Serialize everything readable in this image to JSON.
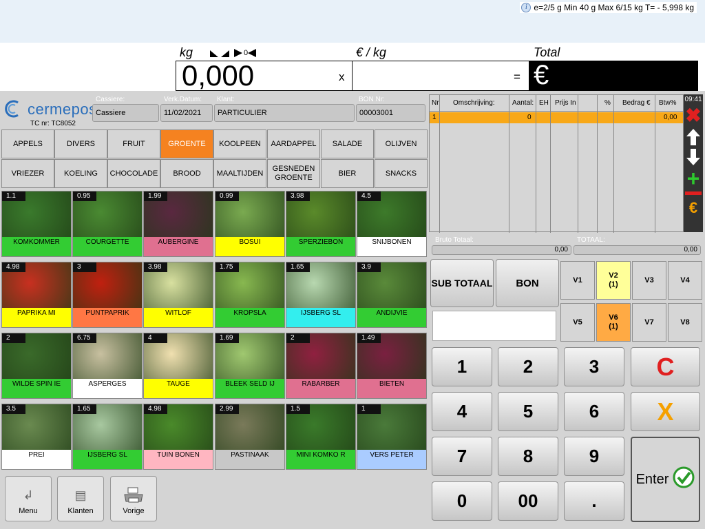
{
  "scale": {
    "info": "e=2/5 g   Min 40 g   Max 6/15 kg  T= - 5,998 kg"
  },
  "display": {
    "kg_label": "kg",
    "zero_indicator": "0",
    "eur_kg_label": "€ / kg",
    "total_label": "Total",
    "weight_value": "0,000",
    "multiply": "x",
    "equals": "=",
    "currency": "€"
  },
  "header": {
    "logo": "cermepos",
    "tc_nr": "TC nr: TC8052",
    "cashier_label": "Cassiere:",
    "cashier_value": "Cassiere",
    "date_label": "Verk.Datum:",
    "date_value": "11/02/2021",
    "client_label": "Klant:",
    "client_value": "PARTICULIER",
    "bon_label": "BON Nr:",
    "bon_value": "00003001"
  },
  "categories": [
    {
      "label": "APPELS"
    },
    {
      "label": "DIVERS"
    },
    {
      "label": "FRUIT"
    },
    {
      "label": "GROENTE",
      "active": true
    },
    {
      "label": "KOOLPEEN"
    },
    {
      "label": "AARDAPPEL"
    },
    {
      "label": "SALADE"
    },
    {
      "label": "OLIJVEN"
    },
    {
      "label": "VRIEZER"
    },
    {
      "label": "KOELING"
    },
    {
      "label": "CHOCOLADE"
    },
    {
      "label": "BROOD"
    },
    {
      "label": "MAALTIJDEN"
    },
    {
      "label": "GESNEDEN GROENTE"
    },
    {
      "label": "BIER"
    },
    {
      "label": "SNACKS"
    }
  ],
  "products": [
    {
      "price": "1.1",
      "name": "KOMKOMMER",
      "color": "#33cc33"
    },
    {
      "price": "0.95",
      "name": "COURGETTE",
      "color": "#33cc33"
    },
    {
      "price": "1.99",
      "name": "AUBERGINE",
      "color": "#e07090"
    },
    {
      "price": "0.99",
      "name": "BOSUI",
      "color": "#ffff00"
    },
    {
      "price": "3.98",
      "name": "SPERZIEBON",
      "color": "#33cc33"
    },
    {
      "price": "4.5",
      "name": "SNIJBONEN",
      "color": "#ffffff"
    },
    {
      "price": "4.98",
      "name": "PAPRIKA MI",
      "color": "#ffff00"
    },
    {
      "price": "3",
      "name": "PUNTPAPRIK",
      "color": "#ff7744"
    },
    {
      "price": "3.98",
      "name": "WITLOF",
      "color": "#ffff00"
    },
    {
      "price": "1.75",
      "name": "KROPSLA",
      "color": "#33cc33"
    },
    {
      "price": "1.65",
      "name": "IJSBERG SL",
      "color": "#33eeee"
    },
    {
      "price": "3.9",
      "name": "ANDIJVIE",
      "color": "#33cc33"
    },
    {
      "price": "2",
      "name": "WILDE SPIN IE",
      "color": "#33cc33"
    },
    {
      "price": "6.75",
      "name": "ASPERGES",
      "color": "#ffffff"
    },
    {
      "price": "4",
      "name": "TAUGE",
      "color": "#ffff00"
    },
    {
      "price": "1.69",
      "name": "BLEEK SELD IJ",
      "color": "#33cc33"
    },
    {
      "price": "2",
      "name": "RABARBER",
      "color": "#e07090"
    },
    {
      "price": "1.49",
      "name": "BIETEN",
      "color": "#e07090"
    },
    {
      "price": "3.5",
      "name": "PREI",
      "color": "#ffffff"
    },
    {
      "price": "1.65",
      "name": "IJSBERG SL",
      "color": "#33cc33"
    },
    {
      "price": "4.98",
      "name": "TUIN BONEN",
      "color": "#ffb6c1"
    },
    {
      "price": "2.99",
      "name": "PASTINAAK",
      "color": "#c8c8c8"
    },
    {
      "price": "1.5",
      "name": "MINI KOMKO R",
      "color": "#33cc33"
    },
    {
      "price": "1",
      "name": "VERS PETER",
      "color": "#aaccff"
    }
  ],
  "bottom": {
    "menu": "Menu",
    "klanten": "Klanten",
    "vorige": "Vorige"
  },
  "receipt": {
    "cols": {
      "nr": "Nr",
      "desc": "Omschrijving:",
      "qty": "Aantal:",
      "unit": "EH",
      "price": "Prijs In",
      "pct": "%",
      "amount": "Bedrag €",
      "vat": "Btw%"
    },
    "row": {
      "nr": "1",
      "qty": "0",
      "vat": "0,00"
    },
    "time": "09:41"
  },
  "totals": {
    "bruto_label": "Bruto Totaal:",
    "bruto_value": "0,00",
    "total_label": "TOTAAL:",
    "total_value": "0,00"
  },
  "actions": {
    "subtotal": "SUB TOTAAL",
    "bon": "BON"
  },
  "vkeys": [
    {
      "label": "V1"
    },
    {
      "label": "V2",
      "sub": "(1)"
    },
    {
      "label": "V3"
    },
    {
      "label": "V4"
    },
    {
      "label": "V5"
    },
    {
      "label": "V6",
      "sub": "(1)"
    },
    {
      "label": "V7"
    },
    {
      "label": "V8"
    }
  ],
  "keypad": {
    "k1": "1",
    "k2": "2",
    "k3": "3",
    "k4": "4",
    "k5": "5",
    "k6": "6",
    "k7": "7",
    "k8": "8",
    "k9": "9",
    "k0": "0",
    "k00": "00",
    "dot": ".",
    "clear": "C",
    "cancel": "X",
    "enter": "Enter"
  },
  "colors": {
    "accent": "#f58220",
    "receipt_row": "#f8a818",
    "v2": "#ffff99",
    "v6": "#ffaa44"
  }
}
